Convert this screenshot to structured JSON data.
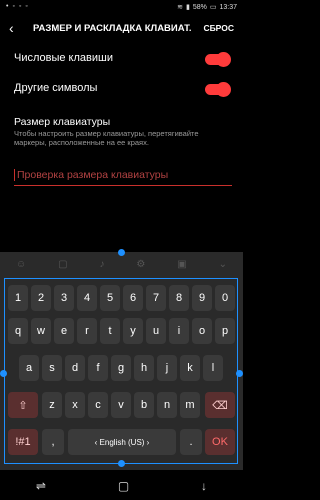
{
  "status": {
    "left_icons": "• ◦ ◦ ◦",
    "battery": "58%",
    "time": "13:37"
  },
  "appbar": {
    "title": "РАЗМЕР И РАСКЛАДКА КЛАВИАТ...",
    "reset": "СБРОС"
  },
  "settings": {
    "numeric_keys": "Числовые клавиши",
    "other_symbols": "Другие символы",
    "size_title": "Размер клавиатуры",
    "size_description": "Чтобы настроить размер клавиатуры, перетягивайте маркеры, расположенные на ее краях.",
    "preview_placeholder": "Проверка размера клавиатуры"
  },
  "keyboard": {
    "numbers": [
      "1",
      "2",
      "3",
      "4",
      "5",
      "6",
      "7",
      "8",
      "9",
      "0"
    ],
    "row1": [
      "q",
      "w",
      "e",
      "r",
      "t",
      "y",
      "u",
      "i",
      "o",
      "p"
    ],
    "row2": [
      "a",
      "s",
      "d",
      "f",
      "g",
      "h",
      "j",
      "k",
      "l"
    ],
    "row3": [
      "z",
      "x",
      "c",
      "v",
      "b",
      "n",
      "m"
    ],
    "bottom": {
      "symbols": "!#1",
      "comma": ",",
      "space": "‹ English (US) ›",
      "period": ".",
      "ok": "OK"
    }
  }
}
